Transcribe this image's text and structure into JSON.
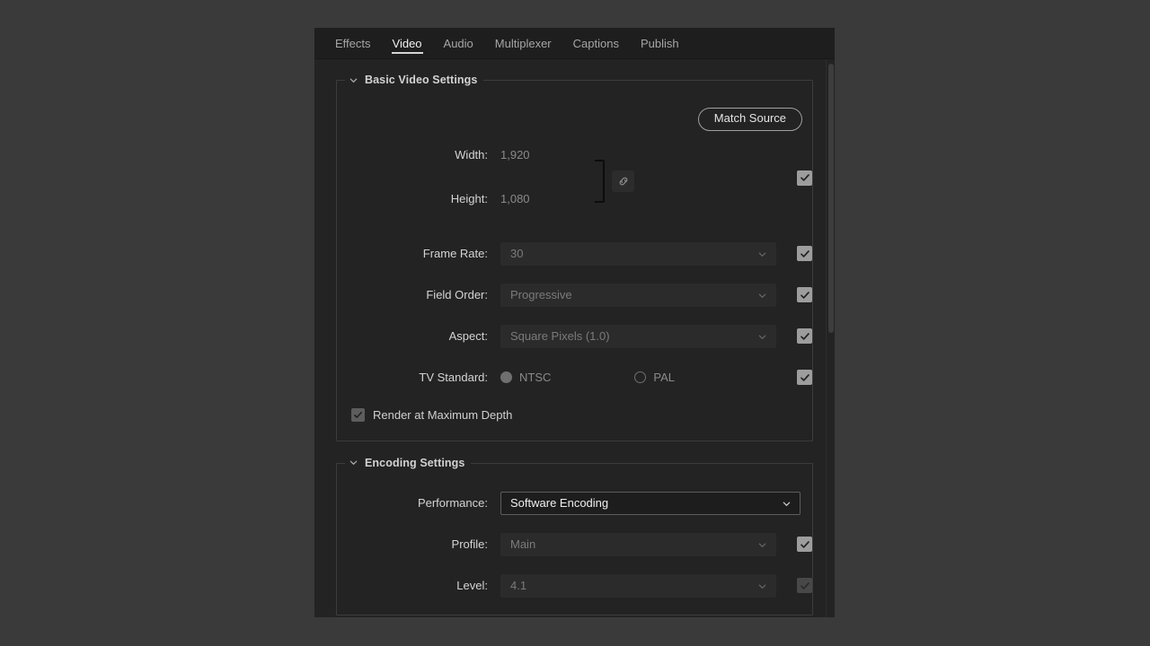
{
  "tabs": [
    {
      "label": "Effects",
      "active": false
    },
    {
      "label": "Video",
      "active": true
    },
    {
      "label": "Audio",
      "active": false
    },
    {
      "label": "Multiplexer",
      "active": false
    },
    {
      "label": "Captions",
      "active": false
    },
    {
      "label": "Publish",
      "active": false
    }
  ],
  "basic_video": {
    "title": "Basic Video Settings",
    "match_source_label": "Match Source",
    "width": {
      "label": "Width:",
      "value": "1,920"
    },
    "height": {
      "label": "Height:",
      "value": "1,080"
    },
    "frame_rate": {
      "label": "Frame Rate:",
      "value": "30"
    },
    "field_order": {
      "label": "Field Order:",
      "value": "Progressive"
    },
    "aspect": {
      "label": "Aspect:",
      "value": "Square Pixels (1.0)"
    },
    "tv_standard": {
      "label": "TV Standard:",
      "ntsc_label": "NTSC",
      "pal_label": "PAL",
      "selected": "NTSC"
    },
    "render_max_depth": {
      "label": "Render at Maximum Depth",
      "checked": true
    }
  },
  "encoding": {
    "title": "Encoding Settings",
    "performance": {
      "label": "Performance:",
      "value": "Software Encoding"
    },
    "profile": {
      "label": "Profile:",
      "value": "Main"
    },
    "level": {
      "label": "Level:",
      "value": "4.1"
    }
  },
  "colors": {
    "page_background": "#3a3a3a",
    "panel_background": "#232323",
    "tabbar_background": "#1e1e1e",
    "active_tab_text": "#f0f0f0",
    "inactive_tab_text": "#a6a6a6",
    "label_text": "#d4d4d4",
    "disabled_value_text": "#7b7b7b",
    "checkbox_enabled": "#9d9d9d",
    "checkbox_disabled": "#484848",
    "section_border": "#3c3c3c",
    "enabled_field_border": "#5c5c5c"
  }
}
